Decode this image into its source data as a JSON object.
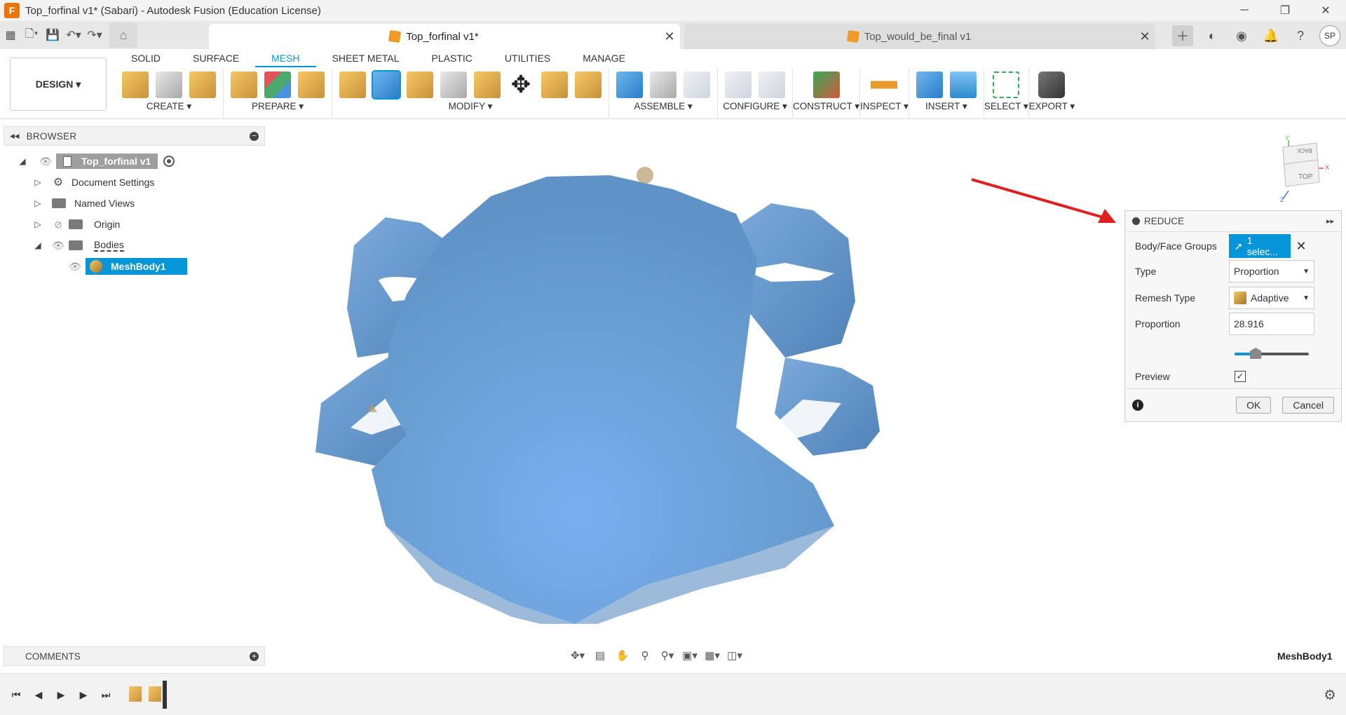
{
  "window": {
    "title": "Top_forfinal v1* (Sabari) - Autodesk Fusion (Education License)",
    "logo_letter": "F",
    "controls": [
      "─",
      "❐",
      "✕"
    ]
  },
  "doc_tabs": {
    "active": "Top_forfinal v1*",
    "inactive": "Top_would_be_final v1",
    "close_symbol": "✕"
  },
  "user": {
    "initials": "SP"
  },
  "ribbon": {
    "workspace": "DESIGN ▾",
    "tabs": [
      "SOLID",
      "SURFACE",
      "MESH",
      "SHEET METAL",
      "PLASTIC",
      "UTILITIES",
      "MANAGE"
    ],
    "active_tab": "MESH",
    "groups": [
      "CREATE ▾",
      "PREPARE ▾",
      "MODIFY ▾",
      "ASSEMBLE ▾",
      "CONFIGURE ▾",
      "CONSTRUCT ▾",
      "INSPECT ▾",
      "INSERT ▾",
      "SELECT ▾",
      "EXPORT ▾"
    ]
  },
  "browser": {
    "title": "BROWSER",
    "root": "Top_forfinal v1",
    "items": [
      "Document Settings",
      "Named Views",
      "Origin",
      "Bodies"
    ],
    "selected_body": "MeshBody1"
  },
  "comments": {
    "title": "COMMENTS"
  },
  "viewcube": {
    "top_face": "TOP",
    "back_face": "BACK",
    "axis_x": "X",
    "axis_y": "Y",
    "axis_z": "Z"
  },
  "reduce": {
    "title": "REDUCE",
    "body_face_label": "Body/Face Groups",
    "selection_value": "1 selec...",
    "type_label": "Type",
    "type_value": "Proportion",
    "remesh_label": "Remesh Type",
    "remesh_value": "Adaptive",
    "proportion_label": "Proportion",
    "proportion_value": "28.916",
    "preview_label": "Preview",
    "preview_checked": true,
    "ok": "OK",
    "cancel": "Cancel"
  },
  "status": {
    "selection": "MeshBody1"
  },
  "colors": {
    "accent": "#0696d7",
    "mesh": "#6a9fd4",
    "arrow": "#e02020"
  }
}
